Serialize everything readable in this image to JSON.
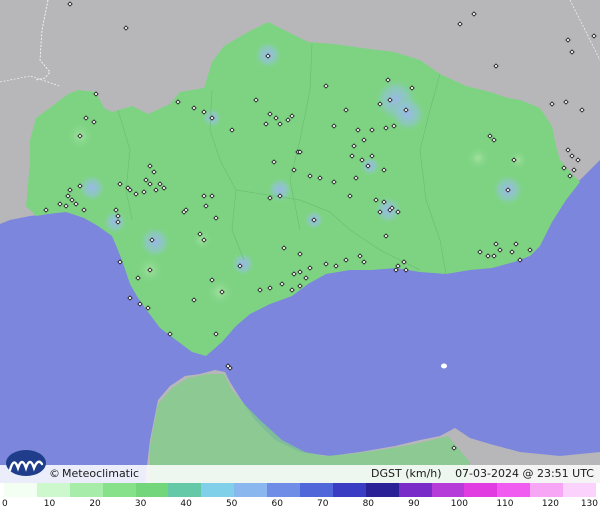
{
  "map": {
    "colors": {
      "sea": "#7b86dc",
      "land_outside": "#b5b5b8",
      "region": "#7ed383",
      "gust_spot": "#9bb6e8",
      "station": "#111111"
    }
  },
  "footer": {
    "brand": "Meteoclimatic",
    "copyright_symbol": "©",
    "variable": "DGST (km/h)",
    "timestamp": "07-03-2024 @ 23:51 UTC"
  },
  "legend": {
    "ticks": [
      "0",
      "10",
      "20",
      "30",
      "40",
      "50",
      "60",
      "70",
      "80",
      "90",
      "100",
      "110",
      "120",
      "130"
    ],
    "colors": [
      "#f2fff2",
      "#cdf7cd",
      "#a7eca9",
      "#86e18a",
      "#74d67b",
      "#65c8a6",
      "#7fd0e8",
      "#8ab8ee",
      "#6f8de6",
      "#4f67d8",
      "#3a3dc4",
      "#2b2196",
      "#7a2cc8",
      "#b63cd9",
      "#e13be2",
      "#f05cf0",
      "#f7a6f6",
      "#fbd2fb"
    ]
  }
}
